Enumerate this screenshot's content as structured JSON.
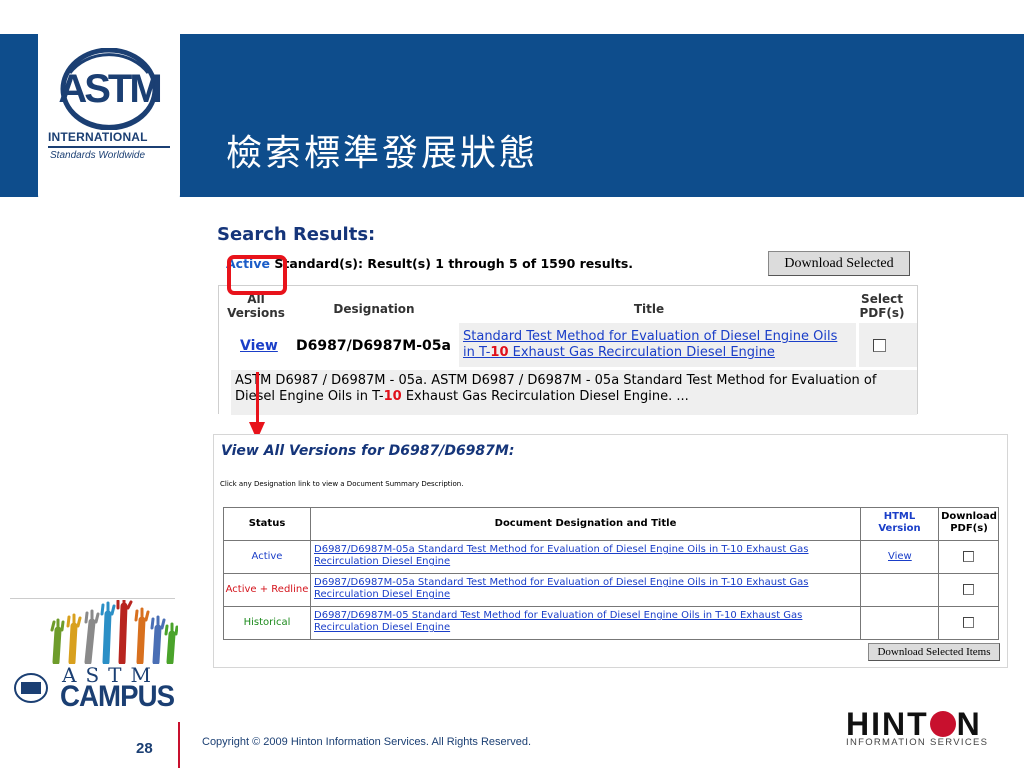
{
  "slide": {
    "title": "檢索標準發展狀態",
    "page_number": "28",
    "copyright": "Copyright © 2009 Hinton Information Services. All Rights Reserved."
  },
  "logos": {
    "astm_mark": "ASTM",
    "astm_international": "INTERNATIONAL",
    "astm_tagline": "Standards Worldwide",
    "campus_astm": "ASTM",
    "campus_word": "CAMPUS",
    "hinton_left": "HINT",
    "hinton_right": "N",
    "hinton_sub": "INFORMATION SERVICES"
  },
  "search_results": {
    "heading": "Search Results:",
    "status_word": "Active",
    "count_text": " Standard(s): Result(s) 1 through 5 of 1590 results.",
    "download_button": "Download Selected",
    "headers": {
      "all_versions": "All Versions",
      "designation": "Designation",
      "title": "Title",
      "select_pdf": "Select PDF(s)"
    },
    "row": {
      "view_link": "View",
      "designation": "D6987/D6987M-05a",
      "title_before": "Standard Test Method for Evaluation of Diesel Engine Oils in T-",
      "title_highlight": "10",
      "title_after": " Exhaust Gas Recirculation Diesel Engine",
      "desc_before": "ASTM D6987 / D6987M - 05a. ASTM D6987 / D6987M - 05a Standard Test Method for Evaluation of Diesel Engine Oils in T-",
      "desc_highlight": "10",
      "desc_after": " Exhaust Gas Recirculation Diesel Engine. ..."
    }
  },
  "all_versions": {
    "heading": "View All Versions for D6987/D6987M:",
    "note": "Click any Designation link to view a Document Summary Description.",
    "headers": {
      "status": "Status",
      "doc": "Document Designation and Title",
      "html": "HTML Version",
      "download": "Download PDF(s)"
    },
    "rows": [
      {
        "status": "Active",
        "status_color": "#1a3ec8",
        "doc": "D6987/D6987M-05a Standard Test Method for Evaluation of Diesel Engine Oils in T-10 Exhaust Gas Recirculation Diesel Engine",
        "html": "View"
      },
      {
        "status": "Active + Redline",
        "status_color": "#d4141c",
        "doc": "D6987/D6987M-05a Standard Test Method for Evaluation of Diesel Engine Oils in T-10 Exhaust Gas Recirculation Diesel Engine",
        "html": ""
      },
      {
        "status": "Historical",
        "status_color": "#1c8a1c",
        "doc": "D6987/D6987M-05 Standard Test Method for Evaluation of Diesel Engine Oils in T-10 Exhaust Gas Recirculation Diesel Engine",
        "html": ""
      }
    ],
    "download_button": "Download Selected Items"
  }
}
